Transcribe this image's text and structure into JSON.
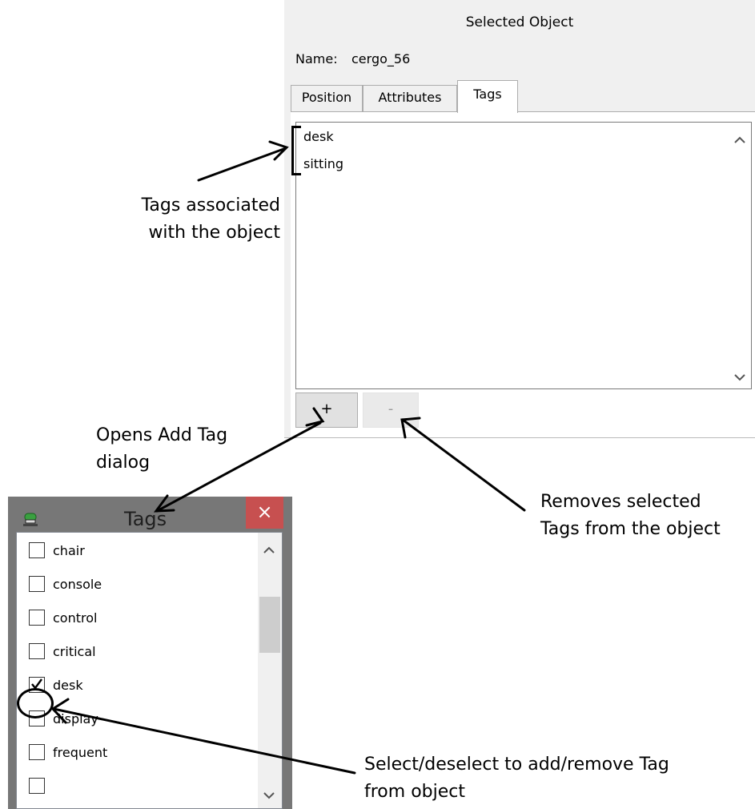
{
  "panel": {
    "title": "Selected Object",
    "name_label": "Name:",
    "name_value": "cergo_56",
    "tabs": [
      {
        "label": "Position"
      },
      {
        "label": "Attributes"
      },
      {
        "label": "Tags"
      }
    ],
    "active_tab": "Tags",
    "tags": [
      "desk",
      "sitting"
    ],
    "add_button": "+",
    "remove_button": "-"
  },
  "dialog": {
    "title": "Tags",
    "close": "×",
    "items": [
      {
        "label": "chair",
        "checked": false
      },
      {
        "label": "console",
        "checked": false
      },
      {
        "label": "control",
        "checked": false
      },
      {
        "label": "critical",
        "checked": false
      },
      {
        "label": "desk",
        "checked": true
      },
      {
        "label": "display",
        "checked": false
      },
      {
        "label": "frequent",
        "checked": false
      }
    ]
  },
  "annotations": {
    "tags_assoc": [
      "Tags associated",
      "with the object"
    ],
    "opens_add": [
      "Opens Add Tag",
      "dialog"
    ],
    "removes": [
      "Removes selected",
      "Tags from the object"
    ],
    "select": [
      "Select/deselect to add/remove Tag",
      "from object"
    ]
  },
  "colors": {
    "close_button": "#c75050",
    "dialog_frame": "#777777",
    "panel_bg": "#f0f0f0"
  },
  "icons": {
    "scroll_up": "chevron-up-icon",
    "scroll_down": "chevron-down-icon",
    "close": "close-icon",
    "app": "app-icon",
    "check": "checkmark-icon"
  }
}
